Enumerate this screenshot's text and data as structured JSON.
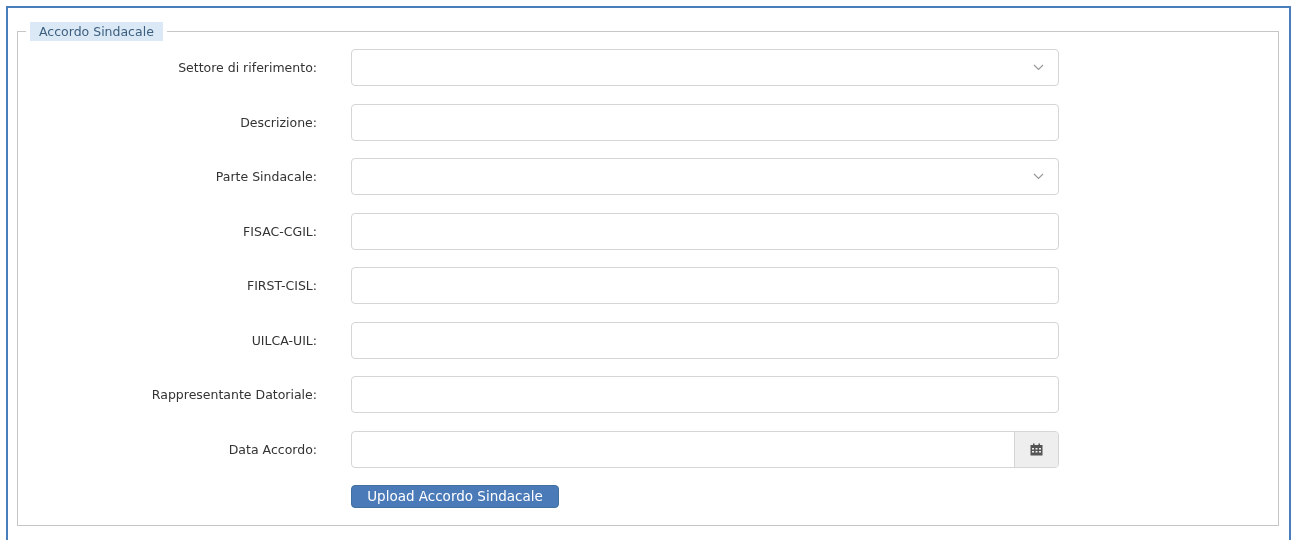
{
  "fieldset": {
    "legend": "Accordo Sindacale"
  },
  "fields": [
    {
      "label": "Settore di riferimento:",
      "kind": "select"
    },
    {
      "label": "Descrizione:",
      "kind": "text"
    },
    {
      "label": "Parte Sindacale:",
      "kind": "select"
    },
    {
      "label": "FISAC-CGIL:",
      "kind": "text"
    },
    {
      "label": "FIRST-CISL:",
      "kind": "text"
    },
    {
      "label": "UILCA-UIL:",
      "kind": "text"
    },
    {
      "label": "Rappresentante Datoriale:",
      "kind": "text"
    },
    {
      "label": "Data Accordo:",
      "kind": "date"
    }
  ],
  "button": "Upload Accordo Sindacale"
}
